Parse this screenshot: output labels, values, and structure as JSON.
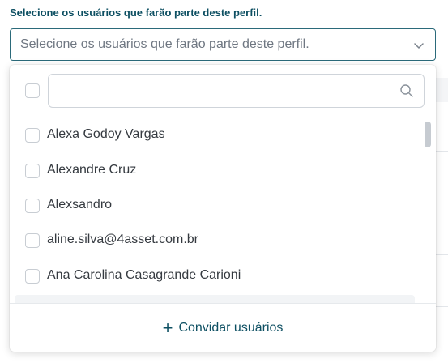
{
  "field": {
    "label": "Selecione os usuários que farão parte deste perfil.",
    "placeholder": "Selecione os usuários que farão parte deste perfil."
  },
  "dropdown": {
    "search": {
      "value": "",
      "placeholder": ""
    },
    "users": [
      {
        "label": "Alexa Godoy Vargas",
        "checked": false
      },
      {
        "label": "Alexandre Cruz",
        "checked": false
      },
      {
        "label": "Alexsandro",
        "checked": false
      },
      {
        "label": "aline.silva@4asset.com.br",
        "checked": false
      },
      {
        "label": "Ana Carolina Casagrande Carioni",
        "checked": false
      }
    ],
    "invite_label": "Convidar usuários"
  },
  "icons": {
    "select": "chevron-down-icon",
    "search": "search-icon",
    "invite": "plus-icon"
  },
  "colors": {
    "label": "#0d4f62",
    "border_focus": "#2b6a7a",
    "accent": "#0d4f62"
  }
}
